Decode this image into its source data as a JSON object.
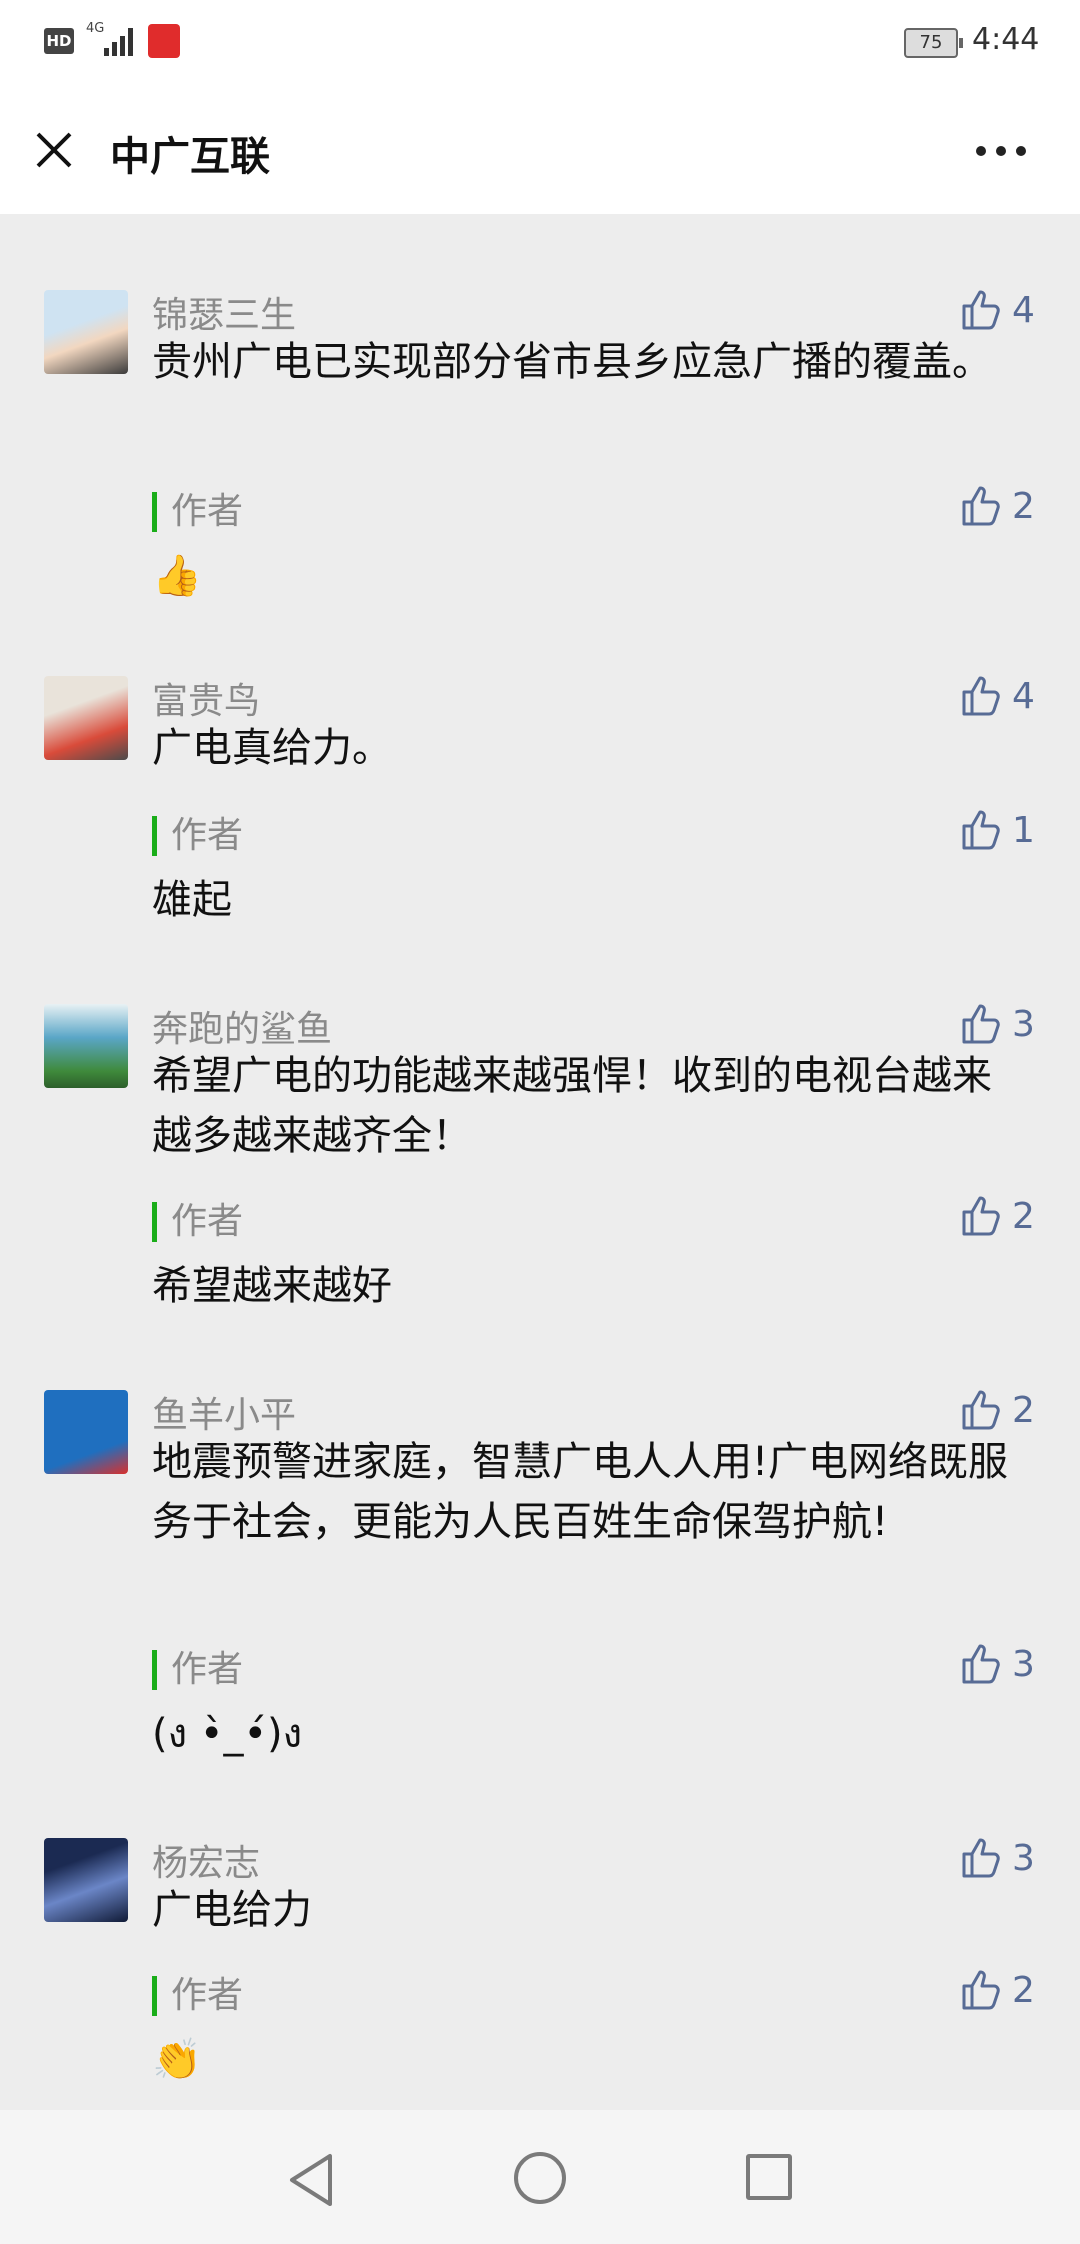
{
  "status_bar": {
    "hd_label": "HD",
    "network_label": "4G",
    "battery_level": "75",
    "time": "4:44"
  },
  "header": {
    "title": "中广互联",
    "close_icon": "close-icon",
    "more_icon": "more-icon"
  },
  "comments": [
    {
      "author": "锦瑟三生",
      "text": "贵州广电已实现部分省市县乡应急广播的覆盖。",
      "likes": "4",
      "reply_label": "作者",
      "reply_text": "👍",
      "reply_likes": "2",
      "avatar_colors": [
        "#cfe3f2",
        "#f2d7c0"
      ]
    },
    {
      "author": "富贵鸟",
      "text": "广电真给力。",
      "likes": "4",
      "reply_label": "作者",
      "reply_text": "雄起",
      "reply_likes": "1",
      "avatar_colors": [
        "#e9e3da",
        "#d94b3a"
      ]
    },
    {
      "author": "奔跑的鲨鱼",
      "text": "希望广电的功能越来越强悍！收到的电视台越来越多越来越齐全！",
      "likes": "3",
      "reply_label": "作者",
      "reply_text": "希望越来越好",
      "reply_likes": "2",
      "avatar_colors": [
        "#5aa6c7",
        "#3f8a3b"
      ]
    },
    {
      "author": "鱼羊小平",
      "text": "地震预警进家庭，智慧广电人人用!广电网络既服务于社会，更能为人民百姓生命保驾护航!",
      "likes": "2",
      "reply_label": "作者",
      "reply_text": "(ง •̀_•́)ง",
      "reply_likes": "3",
      "avatar_colors": [
        "#1f6fbf",
        "#d9302c"
      ]
    },
    {
      "author": "杨宏志",
      "text": "广电给力",
      "likes": "3",
      "reply_label": "作者",
      "reply_text": "👏",
      "reply_likes": "2",
      "avatar_colors": [
        "#1b2a52",
        "#6b86c7"
      ]
    }
  ],
  "navigation": {
    "back_icon": "back-triangle-icon",
    "home_icon": "home-circle-icon",
    "recent_icon": "recent-square-icon"
  }
}
